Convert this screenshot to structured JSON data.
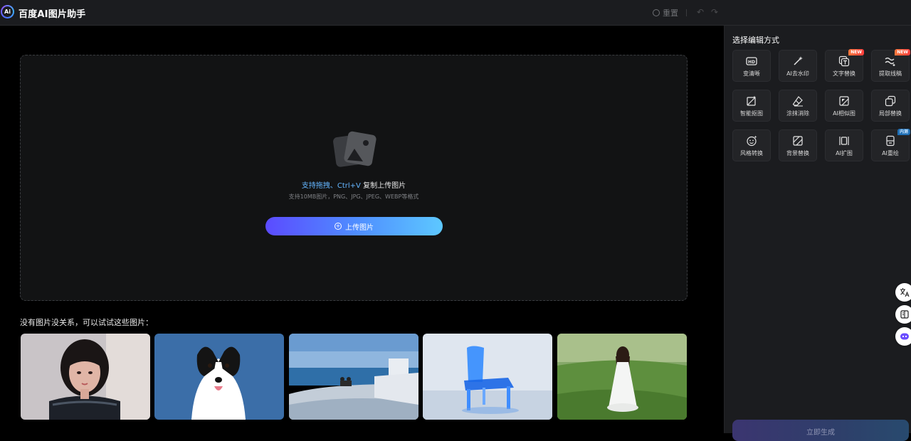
{
  "header": {
    "logo_text": "Ai",
    "app_title": "百度AI图片助手",
    "reset_label": "重置",
    "undo_glyph": "↶",
    "redo_glyph": "↷"
  },
  "upload": {
    "hint_highlight": "支持拖拽、Ctrl+V",
    "hint_rest": " 复制上传图片",
    "formats": "支持10MB图片，PNG、JPG、JPEG、WEBP等格式",
    "button_label": "上传图片",
    "button_icon": "+"
  },
  "samples": {
    "title": "没有图片没关系，可以试试这些图片："
  },
  "panel": {
    "title": "选择编辑方式",
    "tools": [
      {
        "label": "变清晰",
        "icon": "hd-icon"
      },
      {
        "label": "AI去水印",
        "icon": "magic-wand-icon"
      },
      {
        "label": "文字替换",
        "icon": "text-replace-icon",
        "badge": "NEW"
      },
      {
        "label": "提取线稿",
        "icon": "line-extract-icon",
        "badge": "NEW"
      },
      {
        "label": "智能抠图",
        "icon": "smart-cutout-icon"
      },
      {
        "label": "涂抹消除",
        "icon": "eraser-icon"
      },
      {
        "label": "AI相似图",
        "icon": "similar-image-icon"
      },
      {
        "label": "局部替换",
        "icon": "partial-replace-icon"
      },
      {
        "label": "风格转换",
        "icon": "style-transfer-icon"
      },
      {
        "label": "背景替换",
        "icon": "background-replace-icon"
      },
      {
        "label": "AI扩图",
        "icon": "expand-image-icon"
      },
      {
        "label": "AI重绘",
        "icon": "redraw-icon",
        "badge": "内测"
      }
    ],
    "generate_label": "立即生成"
  },
  "colors": {
    "accent_start": "#5b4bff",
    "accent_end": "#5dc8ff",
    "highlight_text": "#64b6ff",
    "badge_new": "#ff5a3d",
    "badge_test": "#1f6fb5"
  }
}
